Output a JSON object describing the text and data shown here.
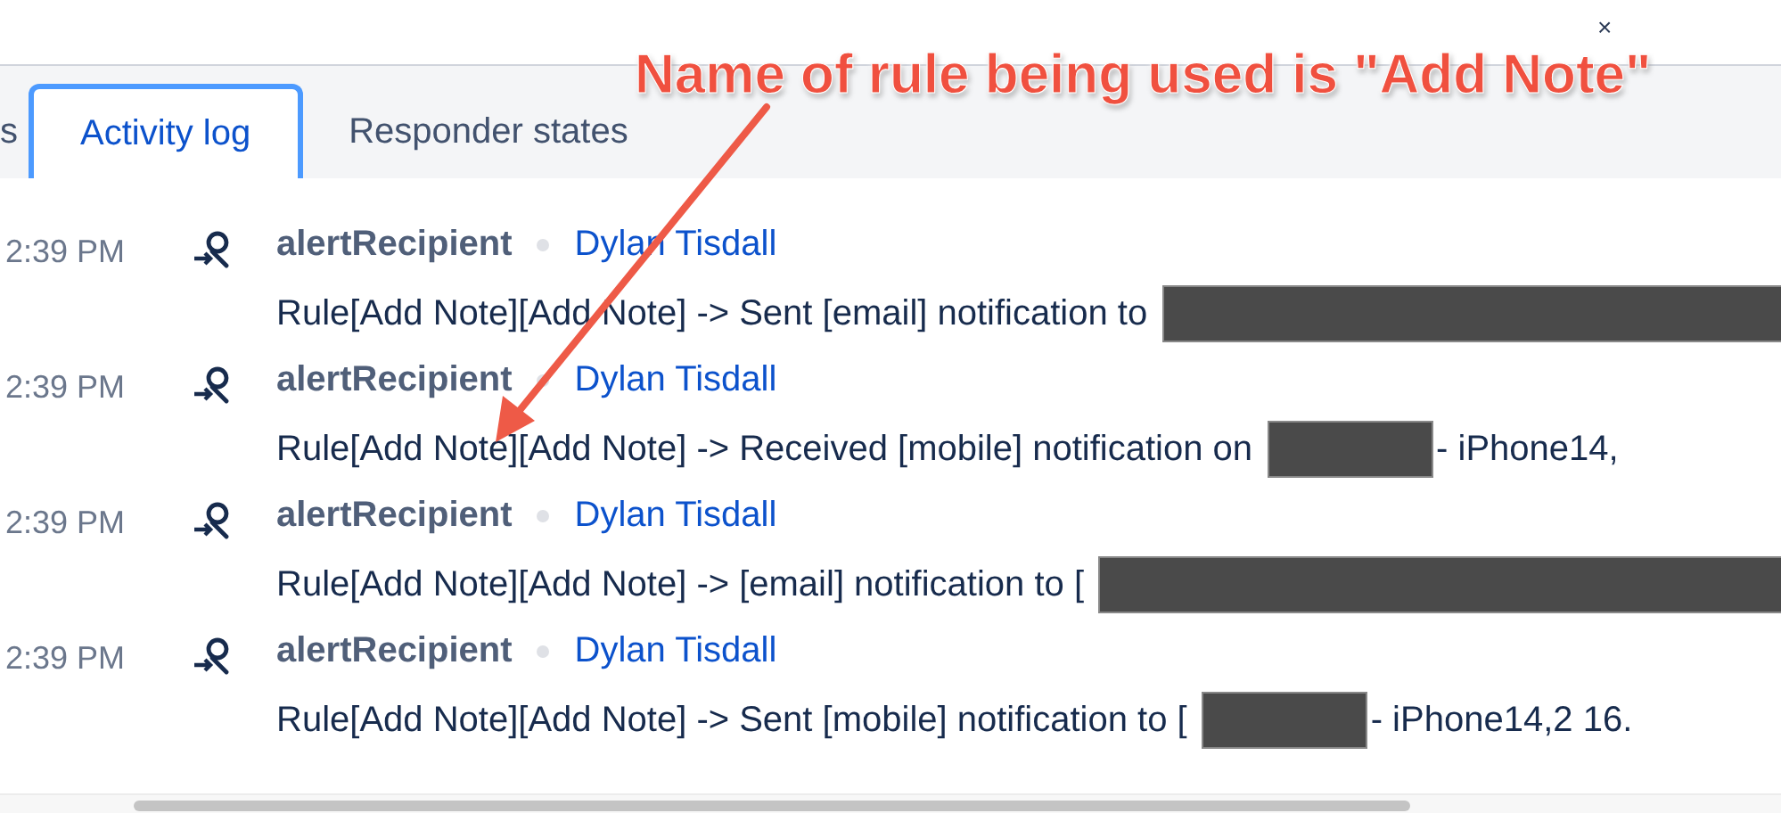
{
  "close_label": "×",
  "tabs": [
    {
      "label": "s",
      "selected": false
    },
    {
      "label": "Activity log",
      "selected": true
    },
    {
      "label": "Responder states",
      "selected": false
    }
  ],
  "entries": [
    {
      "time": "2:39 PM",
      "author": "alertRecipient",
      "user": "Dylan Tisdall",
      "message": [
        {
          "kind": "text",
          "text": "Rule[Add Note][Add Note] -> Sent [email] notification to"
        },
        {
          "kind": "redacted"
        }
      ]
    },
    {
      "time": "2:39 PM",
      "author": "alertRecipient",
      "user": "Dylan Tisdall",
      "message": [
        {
          "kind": "text",
          "text": "Rule[Add Note][Add Note] -> Received [mobile] notification on"
        },
        {
          "kind": "redacted"
        },
        {
          "kind": "text",
          "text": "- iPhone14,"
        }
      ]
    },
    {
      "time": "2:39 PM",
      "author": "alertRecipient",
      "user": "Dylan Tisdall",
      "message": [
        {
          "kind": "text",
          "text": "Rule[Add Note][Add Note] -> [email] notification to ["
        },
        {
          "kind": "redacted"
        }
      ]
    },
    {
      "time": "2:39 PM",
      "author": "alertRecipient",
      "user": "Dylan Tisdall",
      "message": [
        {
          "kind": "text",
          "text": "Rule[Add Note][Add Note] -> Sent [mobile] notification to ["
        },
        {
          "kind": "redacted"
        },
        {
          "kind": "text",
          "text": "- iPhone14,2 16."
        }
      ]
    }
  ],
  "annotation": {
    "text": "Name of rule being used is \"Add Note\""
  }
}
